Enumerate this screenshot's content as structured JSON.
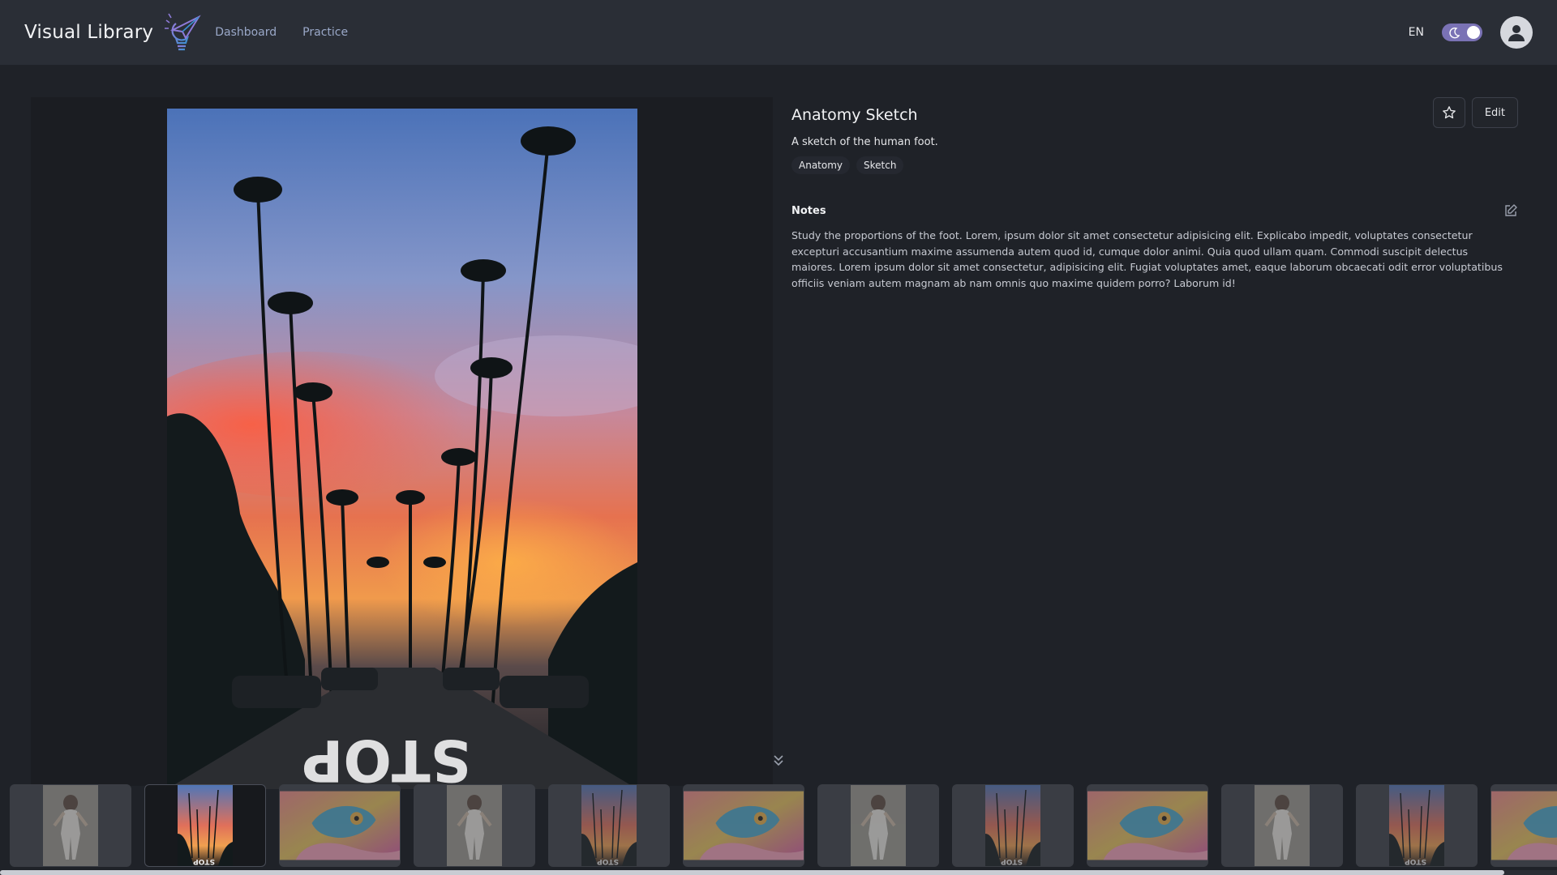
{
  "header": {
    "brand": "Visual Library",
    "logo_icon": "lightbulb-paper-plane-icon",
    "nav": [
      {
        "label": "Dashboard"
      },
      {
        "label": "Practice"
      }
    ],
    "language": "EN",
    "theme_toggle": {
      "icon": "moon-icon",
      "state": "dark"
    },
    "avatar_icon": "user-icon"
  },
  "artwork": {
    "image_subject": "palm-lined street at sunset with STOP road marking",
    "title": "Anatomy Sketch",
    "description": "A sketch of the human foot.",
    "tags": [
      "Anatomy",
      "Sketch"
    ],
    "favorite_icon": "star-icon",
    "edit_label": "Edit"
  },
  "notes": {
    "title": "Notes",
    "edit_icon": "edit-icon",
    "body": "Study the proportions of the foot. Lorem, ipsum dolor sit amet consectetur adipisicing elit. Explicabo impedit, voluptates consectetur excepturi accusantium maxime assumenda autem quod id, cumque dolor animi. Quia quod ullam quam. Commodi suscipit delectus maiores. Lorem ipsum dolor sit amet consectetur, adipisicing elit. Fugiat voluptates amet, eaque laborum obcaecati odit error voluptatibus officiis veniam autem magnam ab nam omnis quo maxime quidem porro? Laborum id!"
  },
  "filmstrip": {
    "thumbnails": [
      {
        "kind": "figure",
        "selected": false
      },
      {
        "kind": "sunset",
        "selected": true
      },
      {
        "kind": "chameleon",
        "selected": false
      },
      {
        "kind": "figure",
        "selected": false
      },
      {
        "kind": "sunset",
        "selected": false
      },
      {
        "kind": "chameleon",
        "selected": false
      },
      {
        "kind": "figure",
        "selected": false
      },
      {
        "kind": "sunset",
        "selected": false
      },
      {
        "kind": "chameleon",
        "selected": false
      },
      {
        "kind": "figure",
        "selected": false
      },
      {
        "kind": "sunset",
        "selected": false
      },
      {
        "kind": "chameleon",
        "selected": false
      }
    ],
    "scroll_icon": "chevrons-down-icon"
  }
}
